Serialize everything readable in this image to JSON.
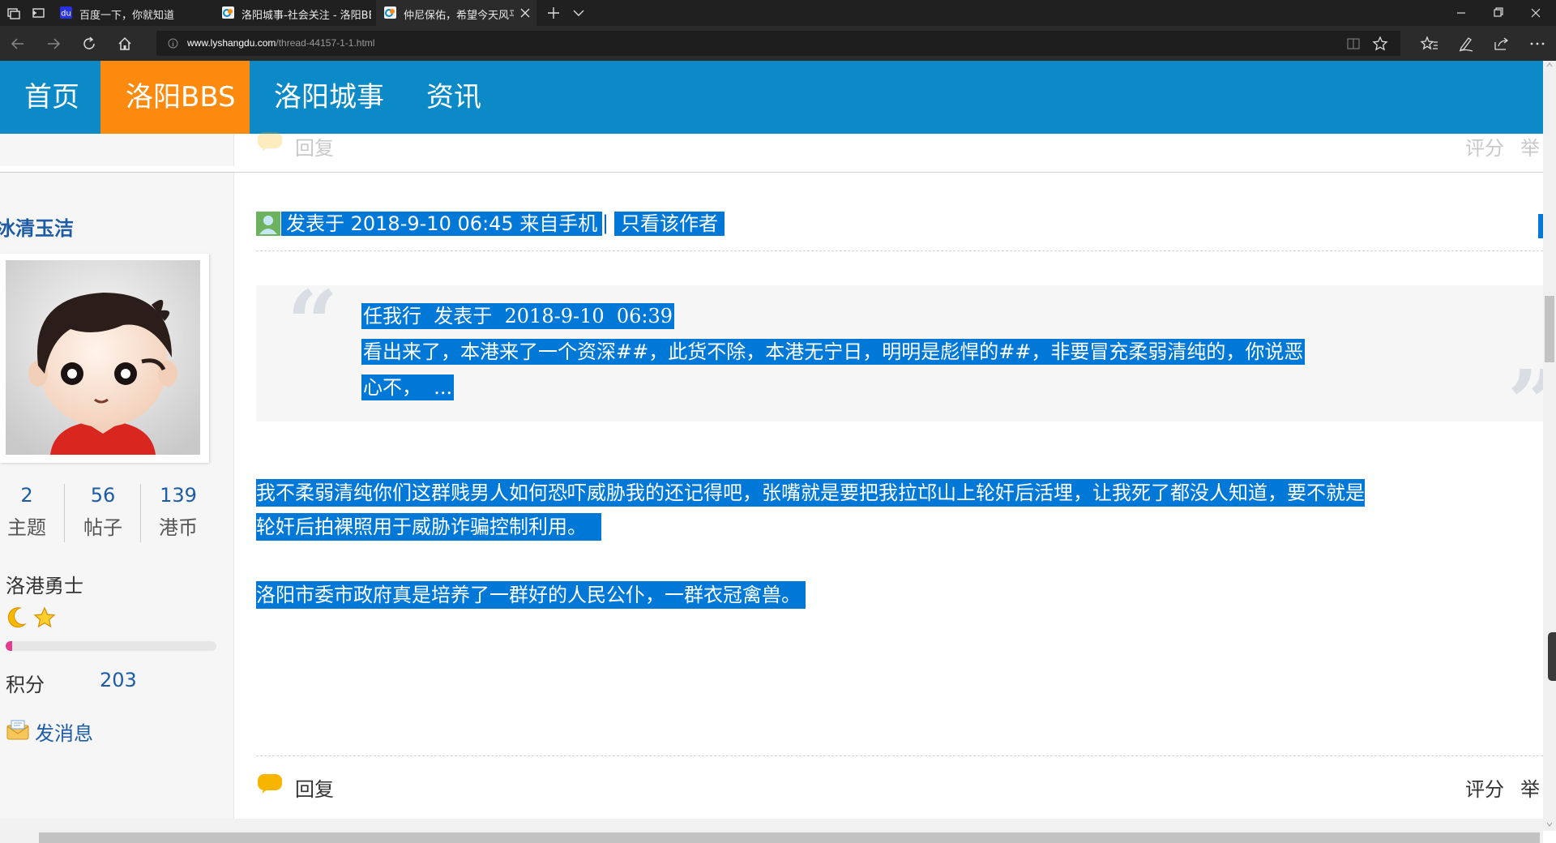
{
  "browser": {
    "tabs": [
      {
        "title": "百度一下，你就知道"
      },
      {
        "title": "洛阳城事-社会关注 - 洛阳BB"
      },
      {
        "title": "仲尼保佑，希望今天风平"
      }
    ],
    "url_host": "www.lyshangdu.com",
    "url_path": "/thread-44157-1-1.html"
  },
  "site_nav": {
    "items": [
      {
        "label": "首页"
      },
      {
        "label": "洛阳BBS"
      },
      {
        "label": "洛阳城事"
      },
      {
        "label": "资讯"
      }
    ]
  },
  "prev_post_footer": {
    "reply": "回复",
    "rate": "评分",
    "report": "举"
  },
  "user": {
    "name": "冰清玉洁",
    "stats": [
      {
        "value": "2",
        "label": "主题"
      },
      {
        "value": "56",
        "label": "帖子"
      },
      {
        "value": "139",
        "label": "港币"
      }
    ],
    "rank": "洛港勇士",
    "points_label": "积分",
    "points_value": "203",
    "message_label": "发消息",
    "level_progress": 0.03
  },
  "post": {
    "meta": "发表于 2018-9-10 06:45 来自手机",
    "separator": "|",
    "only_author": "只看该作者",
    "quote": {
      "header": "任我行  发表于  2018-9-10  06:39",
      "line1": "看出来了，本港来了一个资深##，此货不除，本港无宁日，明明是彪悍的##，非要冒充柔弱清纯的，你说恶",
      "line2": "心不，  ..."
    },
    "body_line1": "我不柔弱清纯你们这群贱男人如何恐吓威胁我的还记得吧，张嘴就是要把我拉邙山上轮奸后活埋，让我死了都没人知道，要不就是",
    "body_line2": "轮奸后拍裸照用于威胁诈骗控制利用。",
    "body_line3": "洛阳市委市政府真是培养了一群好的人民公仆，一群衣冠禽兽。"
  },
  "post_footer": {
    "reply": "回复",
    "rate": "评分",
    "report": "举"
  },
  "colors": {
    "nav_bg": "#0c8ac7",
    "nav_active": "#fb8a0f",
    "selection": "#0078d7",
    "username": "#1d5ca5"
  }
}
